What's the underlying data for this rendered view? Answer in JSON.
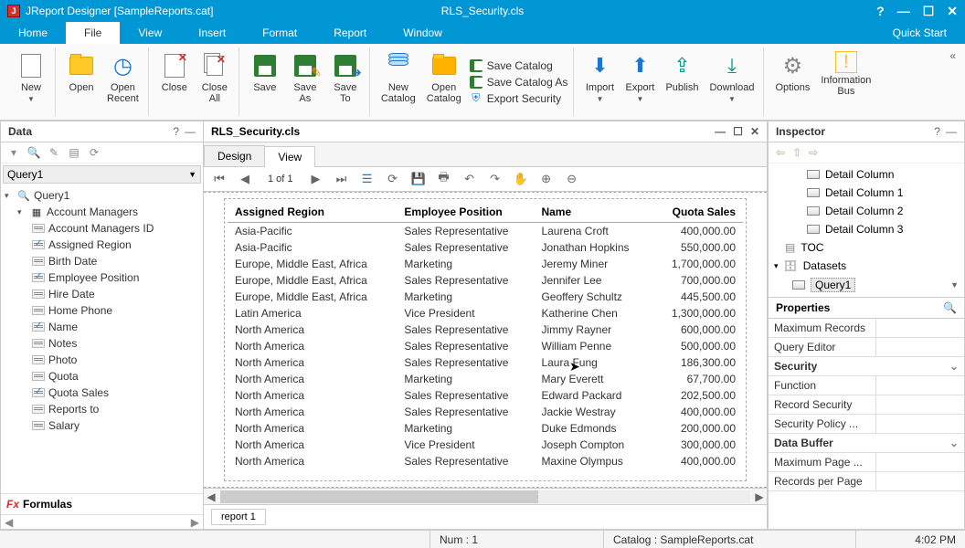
{
  "titlebar": {
    "app": "JReport Designer [SampleReports.cat]",
    "doc": "RLS_Security.cls"
  },
  "menubar": {
    "items": [
      "Home",
      "File",
      "View",
      "Insert",
      "Format",
      "Report",
      "Window"
    ],
    "active": "File",
    "quickstart": "Quick Start"
  },
  "ribbon": {
    "new": "New",
    "open": "Open",
    "open_recent": "Open\nRecent",
    "close": "Close",
    "close_all": "Close\nAll",
    "save": "Save",
    "save_as": "Save\nAs",
    "save_to": "Save\nTo",
    "new_catalog": "New\nCatalog",
    "open_catalog": "Open\nCatalog",
    "save_catalog": "Save Catalog",
    "save_catalog_as": "Save Catalog As",
    "export_security": "Export Security",
    "import": "Import",
    "export": "Export",
    "publish": "Publish",
    "download": "Download",
    "options": "Options",
    "info_bus": "Information\nBus"
  },
  "data_panel": {
    "title": "Data",
    "query_label": "Query1",
    "tree": {
      "query": "Query1",
      "account_managers": "Account Managers",
      "fields": [
        {
          "label": "Account Managers ID",
          "checked": false
        },
        {
          "label": "Assigned Region",
          "checked": true
        },
        {
          "label": "Birth Date",
          "checked": false
        },
        {
          "label": "Employee Position",
          "checked": true
        },
        {
          "label": "Hire Date",
          "checked": false
        },
        {
          "label": "Home Phone",
          "checked": false
        },
        {
          "label": "Name",
          "checked": true
        },
        {
          "label": "Notes",
          "checked": false
        },
        {
          "label": "Photo",
          "checked": false
        },
        {
          "label": "Quota",
          "checked": false
        },
        {
          "label": "Quota Sales",
          "checked": true
        },
        {
          "label": "Reports to",
          "checked": false
        },
        {
          "label": "Salary",
          "checked": false
        }
      ],
      "formulas": "Formulas"
    }
  },
  "center": {
    "doc_title": "RLS_Security.cls",
    "tabs": {
      "design": "Design",
      "view": "View",
      "active": "View"
    },
    "page_info": "1 of 1",
    "report_tab": "report 1",
    "table": {
      "headers": [
        "Assigned Region",
        "Employee Position",
        "Name",
        "Quota Sales"
      ],
      "rows": [
        [
          "Asia-Pacific",
          "Sales Representative",
          "Laurena Croft",
          "400,000.00"
        ],
        [
          "Asia-Pacific",
          "Sales Representative",
          "Jonathan Hopkins",
          "550,000.00"
        ],
        [
          "Europe, Middle East, Africa",
          "Marketing",
          "Jeremy Miner",
          "1,700,000.00"
        ],
        [
          "Europe, Middle East, Africa",
          "Sales Representative",
          "Jennifer Lee",
          "700,000.00"
        ],
        [
          "Europe, Middle East, Africa",
          "Marketing",
          "Geoffery Schultz",
          "445,500.00"
        ],
        [
          "Latin America",
          "Vice President",
          "Katherine Chen",
          "1,300,000.00"
        ],
        [
          "North America",
          "Sales Representative",
          "Jimmy Rayner",
          "600,000.00"
        ],
        [
          "North America",
          "Sales Representative",
          "William Penne",
          "500,000.00"
        ],
        [
          "North America",
          "Sales Representative",
          "Laura Fung",
          "186,300.00"
        ],
        [
          "North America",
          "Marketing",
          "Mary Everett",
          "67,700.00"
        ],
        [
          "North America",
          "Sales Representative",
          "Edward Packard",
          "202,500.00"
        ],
        [
          "North America",
          "Sales Representative",
          "Jackie Westray",
          "400,000.00"
        ],
        [
          "North America",
          "Marketing",
          "Duke Edmonds",
          "200,000.00"
        ],
        [
          "North America",
          "Vice President",
          "Joseph Compton",
          "300,000.00"
        ],
        [
          "North America",
          "Sales Representative",
          "Maxine Olympus",
          "400,000.00"
        ]
      ]
    }
  },
  "inspector": {
    "title": "Inspector",
    "detail_col": "Detail Column",
    "detail_col_1": "Detail Column 1",
    "detail_col_2": "Detail Column 2",
    "detail_col_3": "Detail Column 3",
    "toc": "TOC",
    "datasets": "Datasets",
    "query1": "Query1",
    "properties": "Properties",
    "rows": [
      {
        "k": "Maximum Records",
        "v": ""
      },
      {
        "k": "Query Editor",
        "v": ""
      }
    ],
    "security": "Security",
    "security_rows": [
      {
        "k": "Function",
        "v": ""
      },
      {
        "k": "Record Security",
        "v": ""
      },
      {
        "k": "Security Policy ...",
        "v": ""
      }
    ],
    "data_buffer": "Data Buffer",
    "data_buffer_rows": [
      {
        "k": "Maximum Page ...",
        "v": ""
      },
      {
        "k": "Records per Page",
        "v": ""
      }
    ]
  },
  "statusbar": {
    "num": "Num : 1",
    "catalog": "Catalog : SampleReports.cat",
    "time": "4:02 PM"
  }
}
